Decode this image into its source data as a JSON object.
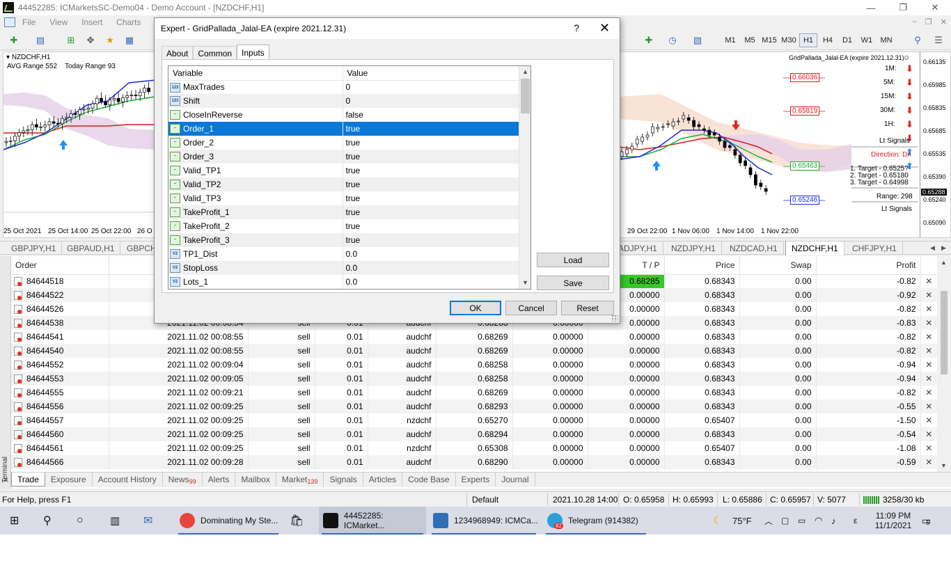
{
  "window": {
    "title": "44452285: ICMarketsSC-Demo04 - Demo Account - [NZDCHF,H1]",
    "controls": [
      "—",
      "❐",
      "✕"
    ]
  },
  "menu": {
    "items": [
      "File",
      "View",
      "Insert",
      "Charts",
      "Too"
    ],
    "right": [
      "–",
      "❐",
      "✕"
    ]
  },
  "toolbar": {
    "timeframes": [
      "M1",
      "M5",
      "M15",
      "M30",
      "H1",
      "H4",
      "D1",
      "W1",
      "MN"
    ],
    "active_timeframe": "H1"
  },
  "chart_left": {
    "symbol": "NZDCHF,H1",
    "avg_range": "AVG Range 552",
    "today_range": "Today Range 93",
    "dates": [
      "25 Oct 2021",
      "25 Oct 14:00",
      "25 Oct 22:00",
      "26 O"
    ]
  },
  "chart_right": {
    "ea_label": "GridPallada_Jalal-EA (expire 2021.12.31)",
    "price_levels": [
      "0.66036",
      "0.65819",
      "0.65463",
      "0.65246"
    ],
    "tf_signals": [
      "1M:",
      "5M:",
      "15M:",
      "30M:",
      "1H:"
    ],
    "lt_signals": "Lt Signals",
    "direction": "Direction: Dn",
    "target1": "1. Target - 0.6525?",
    "target2": "2. Target - 0.65180",
    "target3": "3. Target - 0.64998",
    "range": "Range: 298",
    "lt_signals_bottom": "Lt Signals",
    "axis_prices": [
      "0.66135",
      "0.65985",
      "0.65835",
      "0.65685",
      "0.65535",
      "0.65390",
      "0.65240",
      "0.65090"
    ],
    "current_price": "0.65288",
    "dates": [
      "29 Oct 22:00",
      "1 Nov 06:00",
      "1 Nov 14:00",
      "1 Nov 22:00"
    ]
  },
  "chart_tabs": {
    "left": [
      "GBPJPY,H1",
      "GBPAUD,H1",
      "GBPCH"
    ],
    "right": [
      "ADJPY,H1",
      "NZDJPY,H1",
      "NZDCAD,H1",
      "NZDCHF,H1",
      "CHFJPY,H1"
    ],
    "active": "NZDCHF,H1"
  },
  "terminal": {
    "side_label": "Terminal",
    "columns": {
      "order": "Order",
      "tp": "T / P",
      "price": "Price",
      "swap": "Swap",
      "profit": "Profit"
    },
    "rows": [
      {
        "order": "84644518",
        "time": "",
        "type": "",
        "size": "",
        "symbol": "",
        "open": "",
        "sl": "",
        "tp": "0.68285",
        "price": "0.68343",
        "swap": "0.00",
        "profit": "-0.82"
      },
      {
        "order": "84644522",
        "time": "",
        "type": "",
        "size": "",
        "symbol": "",
        "open": "",
        "sl": "",
        "tp": "0.00000",
        "price": "0.68343",
        "swap": "0.00",
        "profit": "-0.92"
      },
      {
        "order": "84644526",
        "time": "",
        "type": "",
        "size": "",
        "symbol": "",
        "open": "",
        "sl": "",
        "tp": "0.00000",
        "price": "0.68343",
        "swap": "0.00",
        "profit": "-0.82"
      },
      {
        "order": "84644538",
        "time": "2021.11.02 00:08:54",
        "type": "sell",
        "size": "0.01",
        "symbol": "audchf",
        "open": "0.68268",
        "sl": "0.00000",
        "tp": "0.00000",
        "price": "0.68343",
        "swap": "0.00",
        "profit": "-0.83"
      },
      {
        "order": "84644541",
        "time": "2021.11.02 00:08:55",
        "type": "sell",
        "size": "0.01",
        "symbol": "audchf",
        "open": "0.68269",
        "sl": "0.00000",
        "tp": "0.00000",
        "price": "0.68343",
        "swap": "0.00",
        "profit": "-0.82"
      },
      {
        "order": "84644540",
        "time": "2021.11.02 00:08:55",
        "type": "sell",
        "size": "0.01",
        "symbol": "audchf",
        "open": "0.68269",
        "sl": "0.00000",
        "tp": "0.00000",
        "price": "0.68343",
        "swap": "0.00",
        "profit": "-0.82"
      },
      {
        "order": "84644552",
        "time": "2021.11.02 00:09:04",
        "type": "sell",
        "size": "0.01",
        "symbol": "audchf",
        "open": "0.68258",
        "sl": "0.00000",
        "tp": "0.00000",
        "price": "0.68343",
        "swap": "0.00",
        "profit": "-0.94"
      },
      {
        "order": "84644553",
        "time": "2021.11.02 00:09:05",
        "type": "sell",
        "size": "0.01",
        "symbol": "audchf",
        "open": "0.68258",
        "sl": "0.00000",
        "tp": "0.00000",
        "price": "0.68343",
        "swap": "0.00",
        "profit": "-0.94"
      },
      {
        "order": "84644555",
        "time": "2021.11.02 00:09:21",
        "type": "sell",
        "size": "0.01",
        "symbol": "audchf",
        "open": "0.68269",
        "sl": "0.00000",
        "tp": "0.00000",
        "price": "0.68343",
        "swap": "0.00",
        "profit": "-0.82"
      },
      {
        "order": "84644556",
        "time": "2021.11.02 00:09:25",
        "type": "sell",
        "size": "0.01",
        "symbol": "audchf",
        "open": "0.68293",
        "sl": "0.00000",
        "tp": "0.00000",
        "price": "0.68343",
        "swap": "0.00",
        "profit": "-0.55"
      },
      {
        "order": "84644557",
        "time": "2021.11.02 00:09:25",
        "type": "sell",
        "size": "0.01",
        "symbol": "nzdchf",
        "open": "0.65270",
        "sl": "0.00000",
        "tp": "0.00000",
        "price": "0.65407",
        "swap": "0.00",
        "profit": "-1.50"
      },
      {
        "order": "84644560",
        "time": "2021.11.02 00:09:25",
        "type": "sell",
        "size": "0.01",
        "symbol": "audchf",
        "open": "0.68294",
        "sl": "0.00000",
        "tp": "0.00000",
        "price": "0.68343",
        "swap": "0.00",
        "profit": "-0.54"
      },
      {
        "order": "84644561",
        "time": "2021.11.02 00:09:25",
        "type": "sell",
        "size": "0.01",
        "symbol": "nzdchf",
        "open": "0.65308",
        "sl": "0.00000",
        "tp": "0.00000",
        "price": "0.65407",
        "swap": "0.00",
        "profit": "-1.08"
      },
      {
        "order": "84644566",
        "time": "2021.11.02 00:09:28",
        "type": "sell",
        "size": "0.01",
        "symbol": "audchf",
        "open": "0.68290",
        "sl": "0.00000",
        "tp": "0.00000",
        "price": "0.68343",
        "swap": "0.00",
        "profit": "-0.59"
      }
    ],
    "tabs": [
      "Trade",
      "Exposure",
      "Account History",
      "News",
      "Alerts",
      "Mailbox",
      "Market",
      "Signals",
      "Articles",
      "Code Base",
      "Experts",
      "Journal"
    ],
    "news_badge": "99",
    "market_badge": "139",
    "active_tab": "Trade"
  },
  "statusbar": {
    "help": "For Help, press F1",
    "profile": "Default",
    "datetime": "2021.10.28 14:00",
    "open": "O: 0.65958",
    "high": "H: 0.65993",
    "low": "L: 0.65886",
    "close": "C: 0.65957",
    "volume": "V: 5077",
    "traffic": "3258/30 kb"
  },
  "taskbar": {
    "apps": [
      {
        "label": "Dominating My Ste...",
        "color": "#e8453c"
      },
      {
        "label": "44452285: ICMarket...",
        "color": "#111111"
      },
      {
        "label": "1234968949: ICMCa...",
        "color": "#2f6fb7"
      },
      {
        "label": "Telegram (914382)",
        "color": "#2a9fdc"
      }
    ],
    "telegram_badge": "82",
    "weather": "75°F",
    "lang": "ε",
    "time": "11:09 PM",
    "date": "11/1/2021",
    "notifications": "5"
  },
  "dialog": {
    "title": "Expert - GridPallada_Jalal-EA (expire 2021.12.31)",
    "help": "?",
    "close": "✕",
    "tabs": [
      "About",
      "Common",
      "Inputs"
    ],
    "active_tab": "Inputs",
    "columns": {
      "variable": "Variable",
      "value": "Value"
    },
    "inputs": [
      {
        "name": "MaxTrades",
        "value": "0",
        "type": "int"
      },
      {
        "name": "Shift",
        "value": "0",
        "type": "int"
      },
      {
        "name": "CloseInReverse",
        "value": "false",
        "type": "bool"
      },
      {
        "name": "Order_1",
        "value": "true",
        "type": "bool"
      },
      {
        "name": "Order_2",
        "value": "true",
        "type": "bool"
      },
      {
        "name": "Order_3",
        "value": "true",
        "type": "bool"
      },
      {
        "name": "Valid_TP1",
        "value": "true",
        "type": "bool"
      },
      {
        "name": "Valid_TP2",
        "value": "true",
        "type": "bool"
      },
      {
        "name": "Valid_TP3",
        "value": "true",
        "type": "bool"
      },
      {
        "name": "TakeProfit_1",
        "value": "true",
        "type": "bool"
      },
      {
        "name": "TakeProfit_2",
        "value": "true",
        "type": "bool"
      },
      {
        "name": "TakeProfit_3",
        "value": "true",
        "type": "bool"
      },
      {
        "name": "TP1_Dist",
        "value": "0.0",
        "type": "dbl"
      },
      {
        "name": "StopLoss",
        "value": "0.0",
        "type": "dbl"
      },
      {
        "name": "Lots_1",
        "value": "0.0",
        "type": "dbl"
      }
    ],
    "selected_input": "Order_1",
    "type_badges": {
      "int": "123",
      "bool": "~",
      "dbl": "V2"
    },
    "load_label": "Load",
    "save_label": "Save",
    "ok_label": "OK",
    "cancel_label": "Cancel",
    "reset_label": "Reset"
  }
}
